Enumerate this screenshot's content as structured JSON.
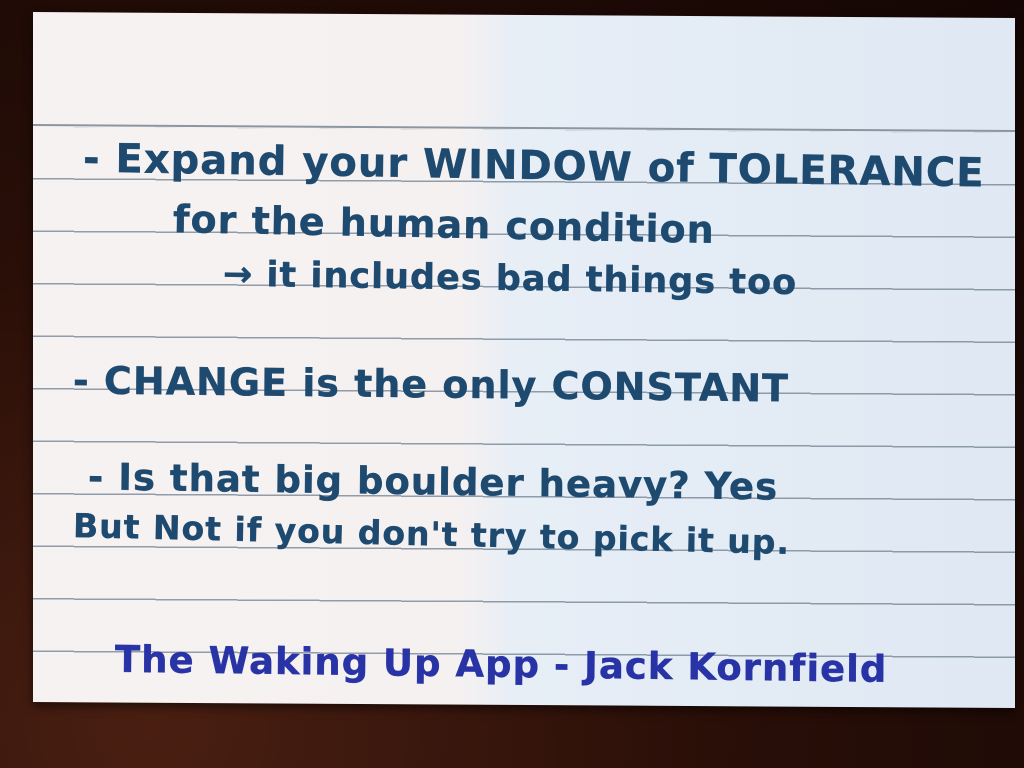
{
  "card": {
    "lines": [
      "- Expand your WINDOW of TOLERANCE",
      "for the human condition",
      "→ it includes bad things too",
      "- CHANGE is the only CONSTANT",
      "- Is that big boulder heavy? Yes",
      "But Not if you don't try to pick it up."
    ],
    "credit": "The Waking Up App - Jack Kornfield"
  },
  "colors": {
    "ink": "#1e4a70",
    "credit_ink": "#2833a6",
    "background": "#2a0f08"
  }
}
